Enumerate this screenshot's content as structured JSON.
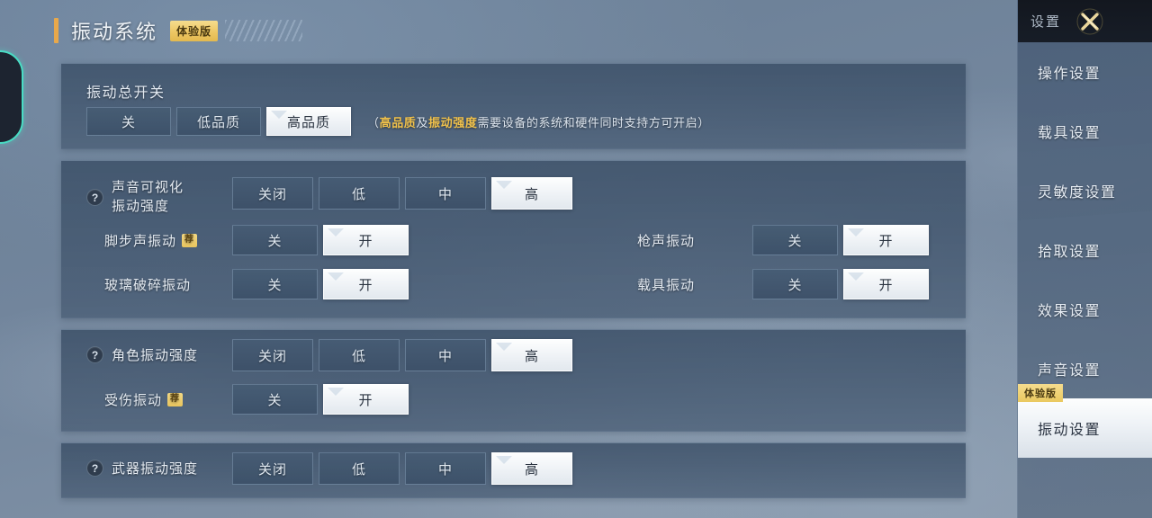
{
  "header": {
    "title": "振动系统",
    "badge": "体验版"
  },
  "sidebar": {
    "title": "设置",
    "close_icon": "close-x-icon",
    "items": [
      {
        "label": "操作设置",
        "active": false
      },
      {
        "label": "载具设置",
        "active": false
      },
      {
        "label": "灵敏度设置",
        "active": false
      },
      {
        "label": "拾取设置",
        "active": false
      },
      {
        "label": "效果设置",
        "active": false
      },
      {
        "label": "声音设置",
        "active": false
      },
      {
        "label": "振动设置",
        "active": true,
        "tag": "体验版"
      }
    ]
  },
  "master_panel": {
    "heading": "振动总开关",
    "options": [
      "关",
      "低品质",
      "高品质"
    ],
    "selected": "高品质",
    "hint_open": "（",
    "hint_hl1": "高品质",
    "hint_mid": "及",
    "hint_hl2": "振动强度",
    "hint_rest": "需要设备的系统和硬件同时支持方可开启）"
  },
  "sound_panel": {
    "intensity": {
      "label_line1": "声音可视化",
      "label_line2": "振动强度",
      "help": "?",
      "options": [
        "关闭",
        "低",
        "中",
        "高"
      ],
      "selected": "高"
    },
    "toggles": [
      {
        "label": "脚步声振动",
        "badge": "荐",
        "options": [
          "关",
          "开"
        ],
        "selected": "开"
      },
      {
        "label": "枪声振动",
        "badge": "",
        "options": [
          "关",
          "开"
        ],
        "selected": "开"
      },
      {
        "label": "玻璃破碎振动",
        "badge": "",
        "options": [
          "关",
          "开"
        ],
        "selected": "开"
      },
      {
        "label": "载具振动",
        "badge": "",
        "options": [
          "关",
          "开"
        ],
        "selected": "开"
      }
    ]
  },
  "character_panel": {
    "intensity": {
      "label": "角色振动强度",
      "help": "?",
      "options": [
        "关闭",
        "低",
        "中",
        "高"
      ],
      "selected": "高"
    },
    "toggle": {
      "label": "受伤振动",
      "badge": "荐",
      "options": [
        "关",
        "开"
      ],
      "selected": "开"
    }
  },
  "weapon_panel": {
    "intensity": {
      "label": "武器振动强度",
      "help": "?",
      "options": [
        "关闭",
        "低",
        "中",
        "高"
      ],
      "selected": "高"
    }
  },
  "colors": {
    "accent_gold": "#e8a84b",
    "badge_yellow": "#edc764",
    "edge_cyan": "#49dcc4",
    "selected_white": "#f2f5f8"
  }
}
